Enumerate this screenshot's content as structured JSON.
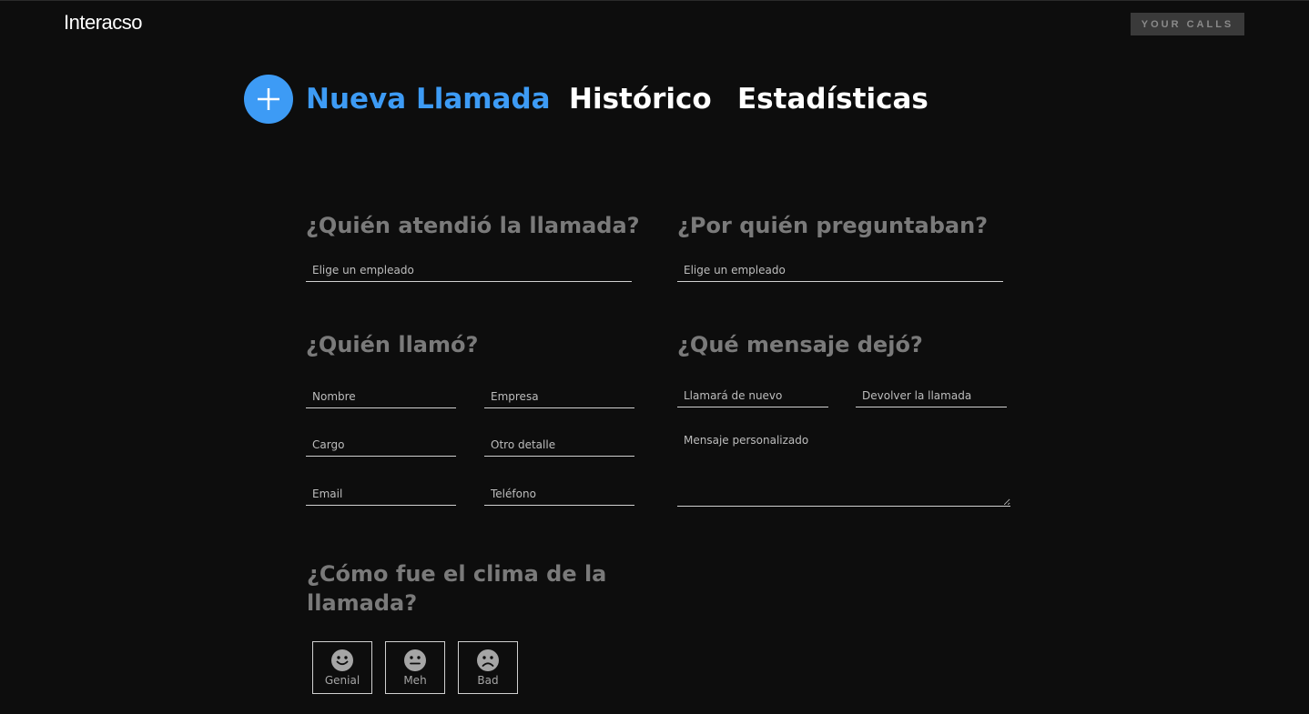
{
  "header": {
    "logo": "Interacso",
    "your_calls_label": "YOUR CALLS"
  },
  "nav": {
    "tabs": [
      {
        "label": "Nueva Llamada",
        "active": true
      },
      {
        "label": "Histórico",
        "active": false
      },
      {
        "label": "Estadísticas",
        "active": false
      }
    ]
  },
  "form": {
    "attended": {
      "title": "¿Quién atendió la llamada?",
      "placeholder": "Elige un empleado"
    },
    "asked_for": {
      "title": "¿Por quién preguntaban?",
      "placeholder": "Elige un empleado"
    },
    "caller": {
      "title": "¿Quién llamó?",
      "fields": {
        "name": "Nombre",
        "company": "Empresa",
        "position": "Cargo",
        "other": "Otro detalle",
        "email": "Email",
        "phone": "Teléfono"
      }
    },
    "message": {
      "title": "¿Qué mensaje dejó?",
      "will_call_again": "Llamará de nuevo",
      "call_back": "Devolver la llamada",
      "custom_placeholder": "Mensaje personalizado"
    },
    "mood": {
      "title_line1": "¿Cómo fue el clima de la",
      "title_line2": "llamada?",
      "options": [
        {
          "label": "Genial",
          "icon": "smile-icon"
        },
        {
          "label": "Meh",
          "icon": "neutral-face-icon"
        },
        {
          "label": "Bad",
          "icon": "frown-icon"
        }
      ]
    }
  },
  "colors": {
    "accent": "#3d9bf5",
    "background": "#0d0d0d",
    "section_title": "#7a7a7a"
  }
}
